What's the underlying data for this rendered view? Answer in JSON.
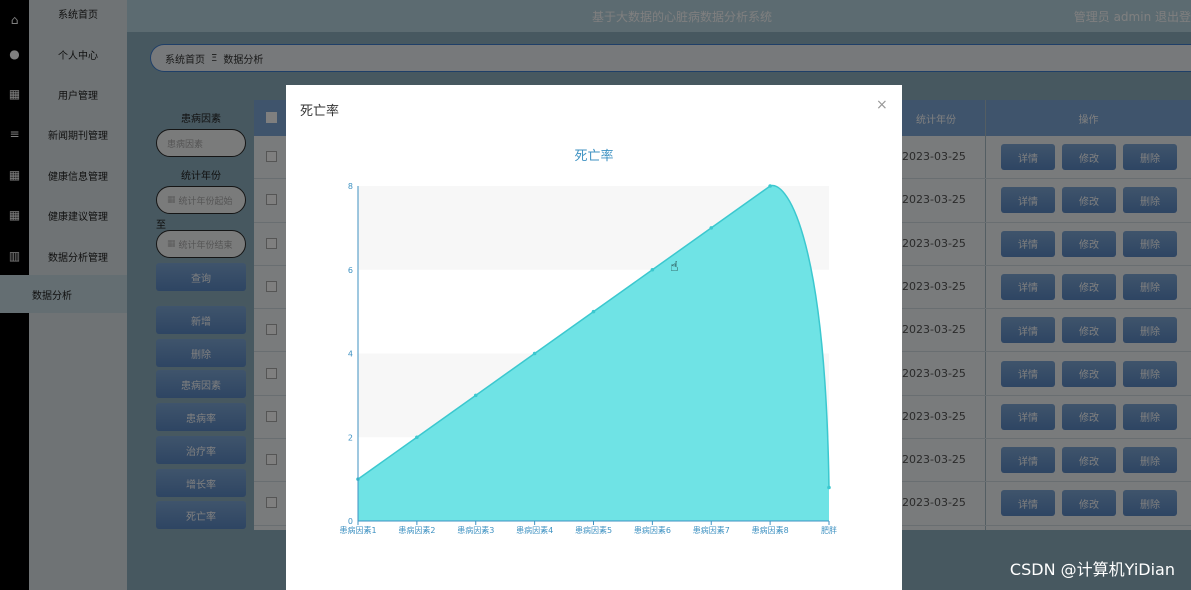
{
  "app": {
    "title": "基于大数据的心脏病数据分析系统",
    "user_area": "管理员 admin  退出登"
  },
  "sidebar": {
    "items": [
      {
        "label": "系统首页"
      },
      {
        "label": "个人中心"
      },
      {
        "label": "用户管理"
      },
      {
        "label": "新闻期刊管理"
      },
      {
        "label": "健康信息管理"
      },
      {
        "label": "健康建议管理"
      },
      {
        "label": "数据分析管理"
      }
    ],
    "active_sub": "数据分析"
  },
  "breadcrumb": {
    "home": "系统首页",
    "separator": "Ξ",
    "current": "数据分析"
  },
  "search": {
    "disease_label": "患病因素",
    "disease_placeholder": "患病因素",
    "year_label": "统计年份",
    "year_start_placeholder": "统计年份起始",
    "to_label": "至",
    "year_end_placeholder": "统计年份结束",
    "query_button": "查询"
  },
  "actions": [
    "新增",
    "删除",
    "患病因素",
    "患病率",
    "治疗率",
    "增长率",
    "死亡率"
  ],
  "table": {
    "col_year": "统计年份",
    "col_ops": "操作",
    "row_date": "2023-03-25",
    "row_count": 9,
    "btn_detail": "详情",
    "btn_edit": "修改",
    "btn_delete": "删除"
  },
  "modal": {
    "title": "死亡率",
    "close": "×"
  },
  "chart_data": {
    "type": "area",
    "title": "死亡率",
    "categories": [
      "患病因素1",
      "患病因素2",
      "患病因素3",
      "患病因素4",
      "患病因素5",
      "患病因素6",
      "患病因素7",
      "患病因素8",
      "肥胖"
    ],
    "values": [
      1,
      2,
      3,
      4,
      5,
      6,
      7,
      8,
      0.8
    ],
    "ylim": [
      0,
      8
    ],
    "yticks": [
      0,
      2,
      4,
      6,
      8
    ],
    "colors": {
      "fill": "#6fe3e5",
      "line": "#3cc8cf",
      "axis": "#3f92c2",
      "band": "#f7f7f7"
    }
  },
  "watermark": "CSDN @计算机YiDian"
}
